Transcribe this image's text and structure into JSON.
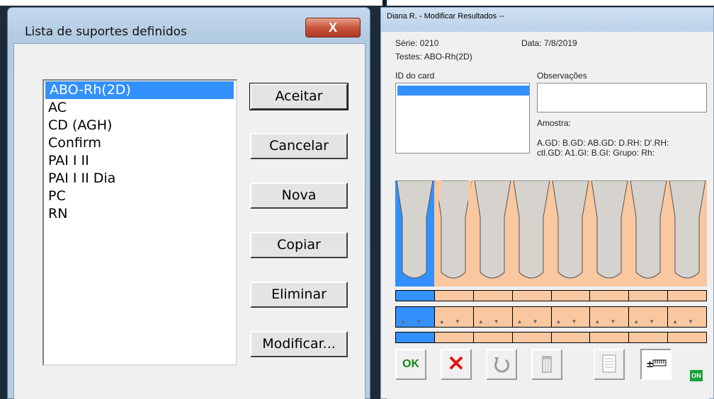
{
  "dialog_left": {
    "title": "Lista de suportes definidos",
    "close_glyph": "X",
    "list_items": [
      "ABO-Rh(2D)",
      "AC",
      "CD (AGH)",
      "Confirm",
      "PAI I II",
      "PAI I II Dia",
      "PC",
      "RN"
    ],
    "selected_index": 0,
    "buttons": {
      "accept": "Aceitar",
      "cancel": "Cancelar",
      "new": "Nova",
      "copy": "Copiar",
      "delete": "Eliminar",
      "modify": "Modificar..."
    }
  },
  "dialog_right": {
    "title": "Diana R. - Modificar Resultados --",
    "serie": "Série: 0210",
    "data": "Data: 7/8/2019",
    "testes": "Testes: ABO-Rh(2D)",
    "id_label": "ID do card",
    "obs_label": "Observações",
    "amostra_label": "Amostra:",
    "results_row1": "A.GD:  B.GD:  AB.GD:  D.RH:  D'.RH:",
    "results_row2": "ctl.GD:  A1.GI:  B.GI:  Grupo:   Rh:",
    "ok_label": "OK",
    "cancel_glyph": "✕",
    "on_badge": "ON",
    "colors": {
      "selected": "#3390ff",
      "well": "#f9c7a0",
      "tube": "#d6d2ce"
    },
    "toolbar_icons": [
      "ok-icon",
      "cancel-x-icon",
      "undo-icon",
      "trash-icon",
      "report-icon",
      "adjust-icon"
    ]
  }
}
